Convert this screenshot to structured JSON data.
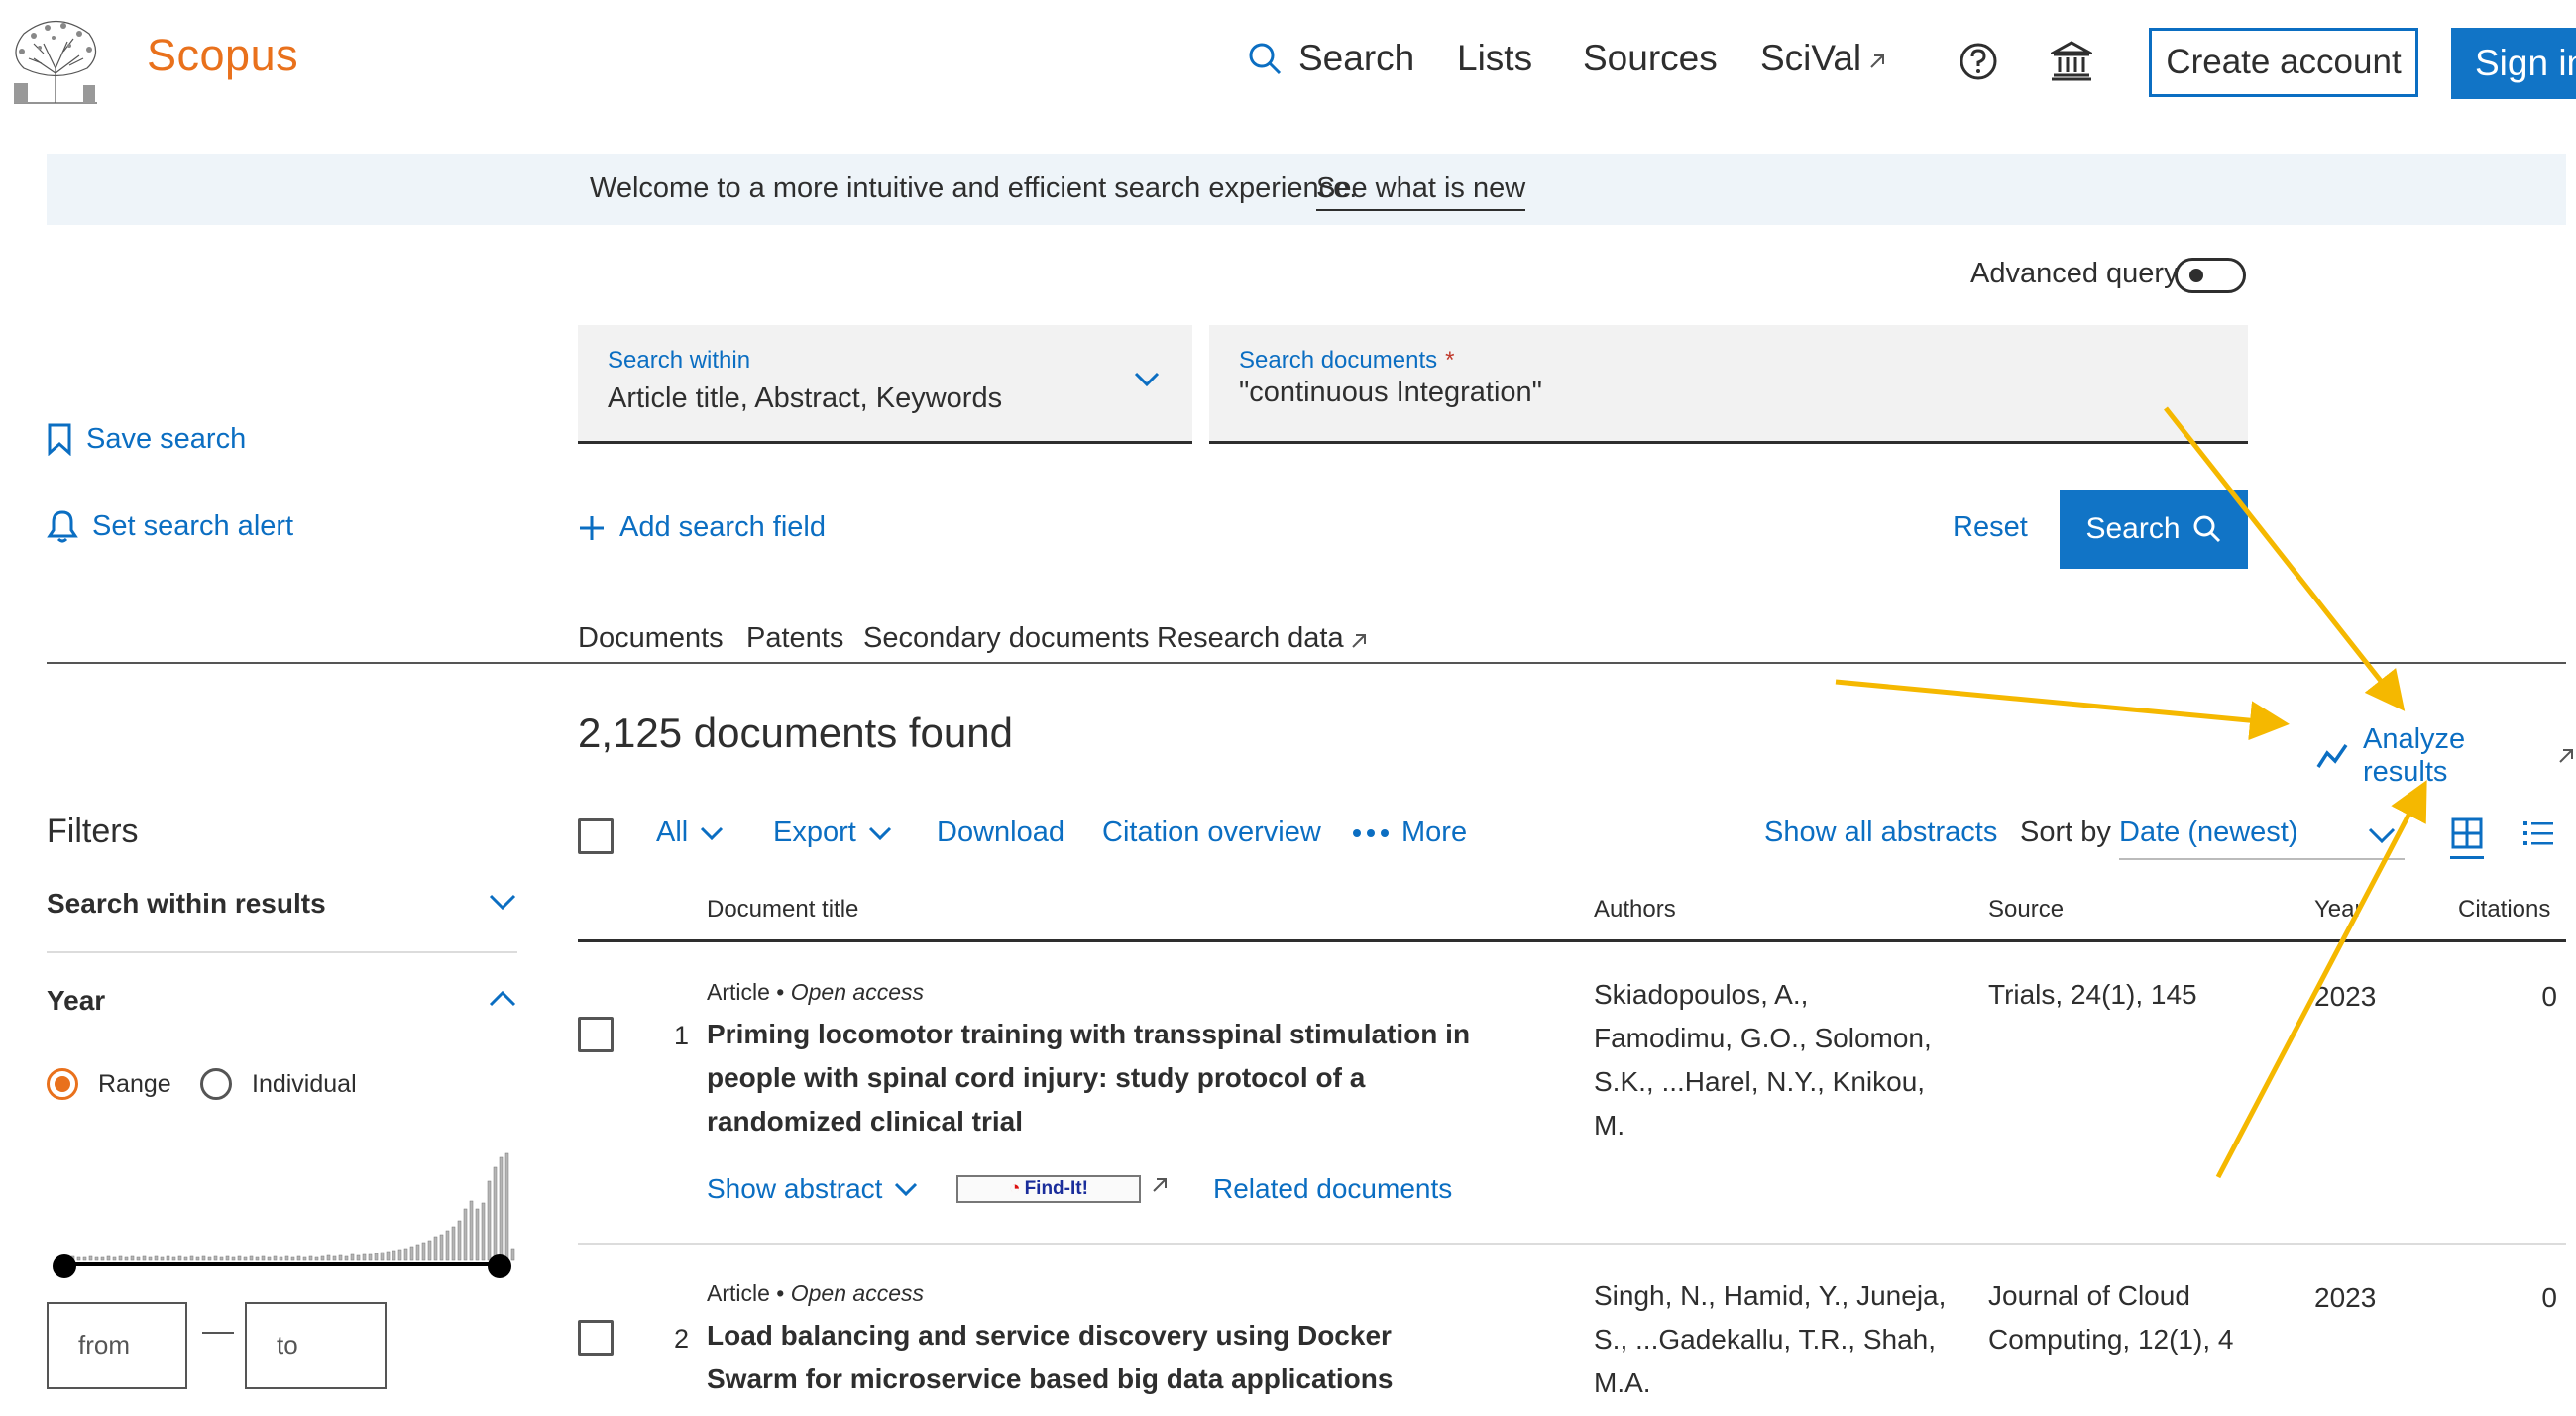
{
  "brand": "Scopus",
  "nav": {
    "search": "Search",
    "lists": "Lists",
    "sources": "Sources",
    "scival": "SciVal",
    "create_account": "Create account",
    "sign_in": "Sign in"
  },
  "banner": {
    "text": "Welcome to a more intuitive and efficient search experience.",
    "link": "See what is new"
  },
  "advanced_query": "Advanced query",
  "search_form": {
    "within_label": "Search within",
    "within_value": "Article title, Abstract, Keywords",
    "docs_label": "Search documents",
    "docs_required": "*",
    "docs_value": "\"continuous Integration\"",
    "add_field": "Add search field",
    "reset": "Reset",
    "search_button": "Search"
  },
  "left_actions": {
    "save_search": "Save search",
    "set_alert": "Set search alert"
  },
  "tabs": [
    "Documents",
    "Patents",
    "Secondary documents",
    "Research data"
  ],
  "results_count": "2,125 documents found",
  "analyze_results": "Analyze results",
  "filters": {
    "title": "Filters",
    "search_within": "Search within results",
    "year": "Year",
    "range": "Range",
    "individual": "Individual",
    "from_placeholder": "from",
    "to_placeholder": "to"
  },
  "toolbar": {
    "all": "All",
    "export": "Export",
    "download": "Download",
    "citation_overview": "Citation overview",
    "more": "More",
    "show_all_abstracts": "Show all abstracts",
    "sort_by": "Sort by",
    "sort_value": "Date (newest)"
  },
  "columns": {
    "title": "Document title",
    "authors": "Authors",
    "source": "Source",
    "year": "Year",
    "citations": "Citations"
  },
  "results": [
    {
      "num": "1",
      "type": "Article",
      "access": "Open access",
      "title": "Priming locomotor training with transspinal stimulation in people with spinal cord injury: study protocol of a randomized clinical trial",
      "authors": "Skiadopoulos, A., Famodimu, G.O., Solomon, S.K., ...Harel, N.Y., Knikou, M.",
      "source": "Trials, 24(1), 145",
      "year": "2023",
      "citations": "0",
      "show_abstract": "Show abstract",
      "findit": "Find-It!",
      "related": "Related documents"
    },
    {
      "num": "2",
      "type": "Article",
      "access": "Open access",
      "title": "Load balancing and service discovery using Docker Swarm for microservice based big data applications",
      "authors": "Singh, N., Hamid, Y., Juneja, S., ...Gadekallu, T.R., Shah, M.A.",
      "source": "Journal of Cloud Computing, 12(1), 4",
      "year": "2023",
      "citations": "0"
    }
  ],
  "colors": {
    "brand": "#e9711c",
    "link": "#0b6ec2",
    "button": "#1174c6",
    "annotation_arrow": "#f5b800",
    "radio_selected": "#e9711c"
  }
}
